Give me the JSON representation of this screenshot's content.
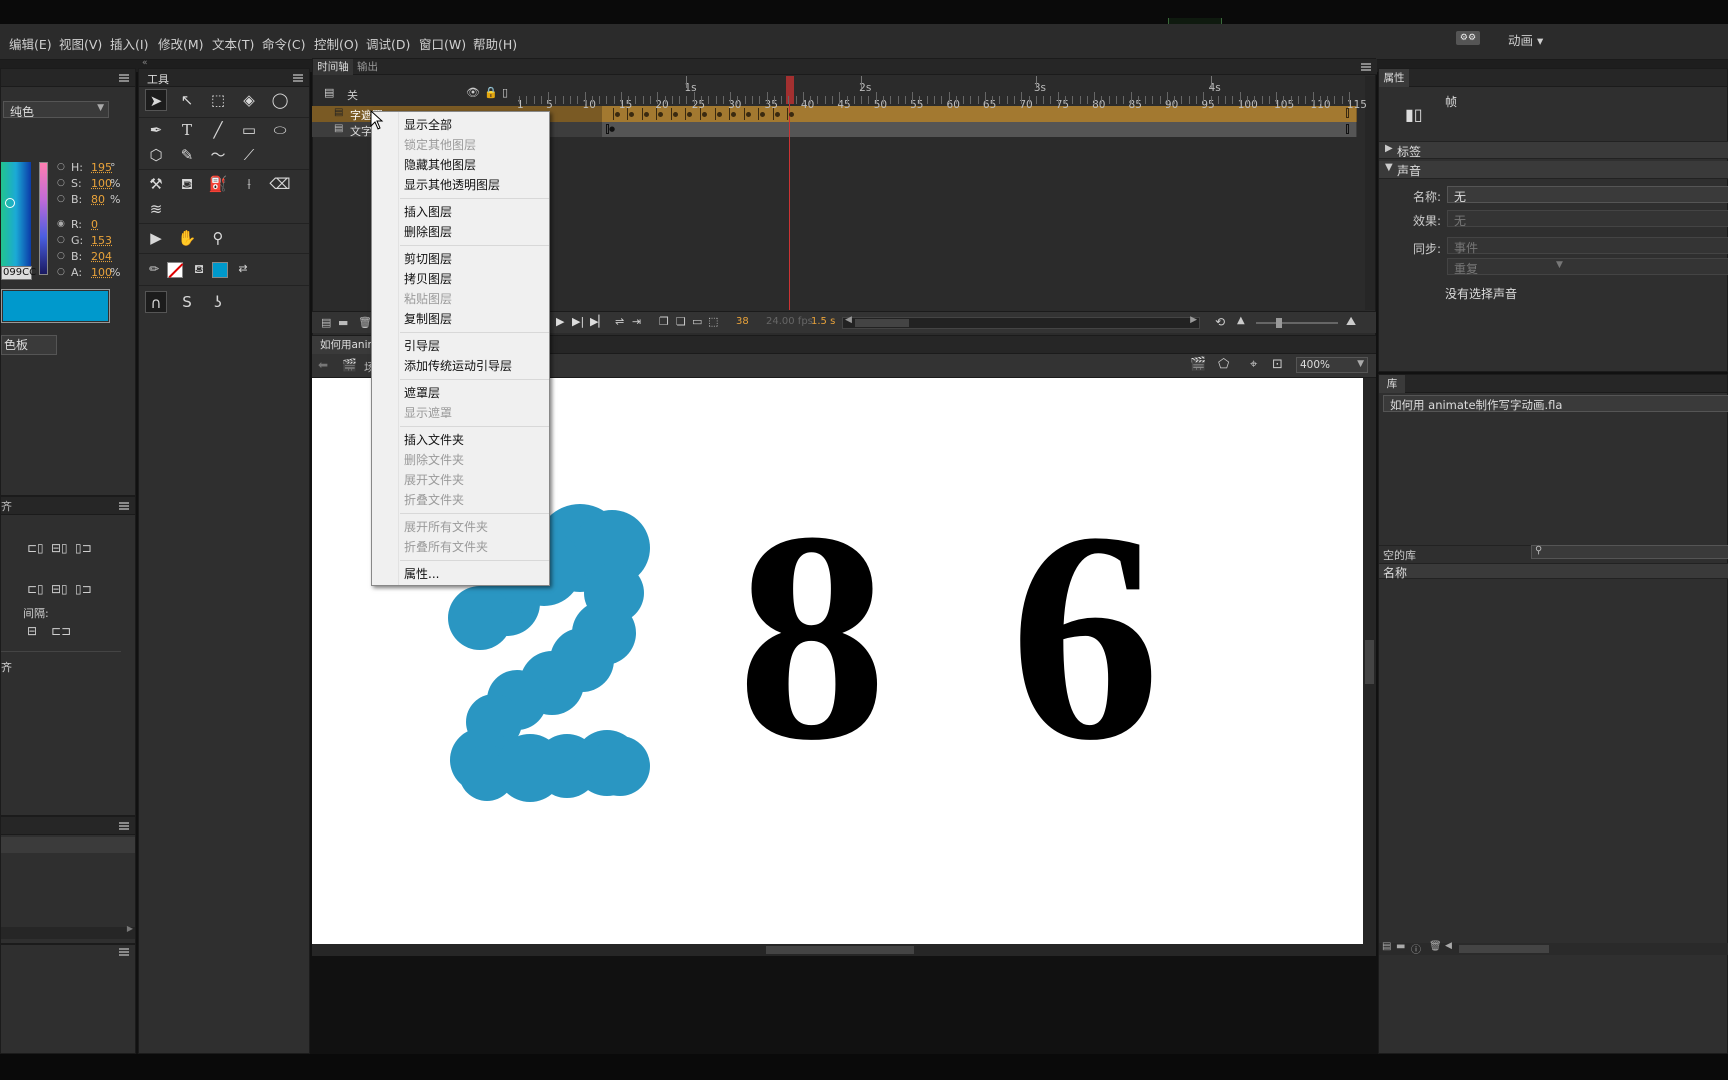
{
  "menu": [
    "编辑(E)",
    "视图(V)",
    "插入(I)",
    "修改(M)",
    "文本(T)",
    "命令(C)",
    "控制(O)",
    "调试(D)",
    "窗口(W)",
    "帮助(H)"
  ],
  "workspace": {
    "label": "动画"
  },
  "color_panel": {
    "fill_type": "纯色",
    "hsb": [
      {
        "k": "H:",
        "v": "195",
        "u": "°"
      },
      {
        "k": "S:",
        "v": "100",
        "u": "%"
      },
      {
        "k": "B:",
        "v": "80",
        "u": "%"
      }
    ],
    "rgb": [
      {
        "k": "R:",
        "v": "0"
      },
      {
        "k": "G:",
        "v": "153"
      },
      {
        "k": "B:",
        "v": "204"
      },
      {
        "k": "A:",
        "v": "100",
        "u": "%"
      }
    ],
    "hex": "099CC",
    "swatch_color": "#0099cc",
    "button": "色板"
  },
  "align_panel": {
    "spacing_label": "间隔:",
    "left_cut_label": "齐",
    "panel_title_cut": "齐"
  },
  "tools": {
    "title": "工具"
  },
  "timeline": {
    "tabs": [
      "时间轴",
      "输出"
    ],
    "layer_header": "关",
    "layers": [
      "字遮罩",
      "文字"
    ],
    "seconds": [
      "1s",
      "2s",
      "3s",
      "4s"
    ],
    "frames": [
      "1",
      "5",
      "10",
      "15",
      "20",
      "25",
      "30",
      "35",
      "40",
      "45",
      "50",
      "55",
      "60",
      "65",
      "70",
      "75",
      "80",
      "85",
      "90",
      "95",
      "100",
      "105",
      "110",
      "115"
    ],
    "current_frame": "38",
    "fps": "24.00 fps",
    "time": "1.5 s"
  },
  "context_menu": {
    "groups": [
      [
        {
          "t": "显示全部",
          "d": false
        },
        {
          "t": "锁定其他图层",
          "d": true
        },
        {
          "t": "隐藏其他图层",
          "d": false
        },
        {
          "t": "显示其他透明图层",
          "d": false
        }
      ],
      [
        {
          "t": "插入图层",
          "d": false
        },
        {
          "t": "删除图层",
          "d": false
        }
      ],
      [
        {
          "t": "剪切图层",
          "d": false
        },
        {
          "t": "拷贝图层",
          "d": false
        },
        {
          "t": "粘贴图层",
          "d": true
        },
        {
          "t": "复制图层",
          "d": false
        }
      ],
      [
        {
          "t": "引导层",
          "d": false
        },
        {
          "t": "添加传统运动引导层",
          "d": false
        }
      ],
      [
        {
          "t": "遮罩层",
          "d": false
        },
        {
          "t": "显示遮罩",
          "d": true
        }
      ],
      [
        {
          "t": "插入文件夹",
          "d": false
        },
        {
          "t": "删除文件夹",
          "d": true
        },
        {
          "t": "展开文件夹",
          "d": true
        },
        {
          "t": "折叠文件夹",
          "d": true
        }
      ],
      [
        {
          "t": "展开所有文件夹",
          "d": true
        },
        {
          "t": "折叠所有文件夹",
          "d": true
        }
      ],
      [
        {
          "t": "属性...",
          "d": false
        }
      ]
    ]
  },
  "document": {
    "tab": "如何用anim",
    "zoom": "400%",
    "scene_cut": "场"
  },
  "stage": {
    "digits": [
      "2",
      "8",
      "6"
    ]
  },
  "properties": {
    "tab": "属性",
    "frame_label": "帧",
    "sections": [
      "标签",
      "声音"
    ],
    "name_label": "名称:",
    "name_value": "无",
    "effect_label": "效果:",
    "effect_value": "无",
    "sync_label": "同步:",
    "sync_value": "事件",
    "repeat_value": "重复",
    "no_sound": "没有选择声音"
  },
  "library": {
    "tab": "库",
    "file": "如何用 animate制作写字动画.fla",
    "empty": "空的库",
    "column": "名称"
  }
}
